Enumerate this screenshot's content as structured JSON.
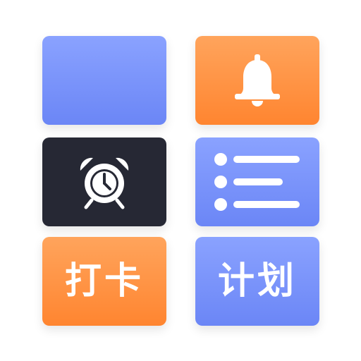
{
  "tiles": [
    {
      "id": "blank-blue-tile",
      "label": ""
    },
    {
      "id": "bell-tile",
      "icon": "bell-icon"
    },
    {
      "id": "alarm-tile",
      "icon": "alarm-clock-icon"
    },
    {
      "id": "list-tile",
      "icon": "list-icon"
    },
    {
      "id": "checkin-tile",
      "label": "打卡"
    },
    {
      "id": "plan-tile",
      "label": "计划"
    }
  ],
  "colors": {
    "blue": "#7a93fa",
    "orange": "#ff9040",
    "dark": "#262834",
    "white": "#ffffff"
  }
}
